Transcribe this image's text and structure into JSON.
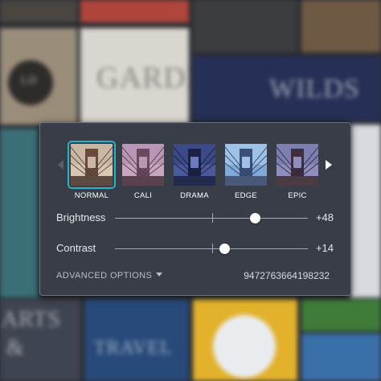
{
  "background_tiles": {
    "top_left": "LD",
    "garden": "GARDEN",
    "wild": "WILDS",
    "arts": "ARTS",
    "arts_amp": "&",
    "travel": "TRAVEL"
  },
  "filter_panel": {
    "prev_icon": "chevron-left-icon",
    "next_icon": "chevron-right-icon",
    "selected_filter": "NORMAL",
    "filters": [
      {
        "label": "NORMAL"
      },
      {
        "label": "CALI"
      },
      {
        "label": "DRAMA"
      },
      {
        "label": "EDGE"
      },
      {
        "label": "EPIC"
      }
    ],
    "brightness": {
      "label": "Brightness",
      "value": "+48"
    },
    "contrast": {
      "label": "Contrast",
      "value": "+14"
    },
    "advanced_label": "ADVANCED OPTIONS",
    "code": "9472763664198232"
  },
  "colors": {
    "accent": "#25b3c6",
    "panel_bg": "#3a3e48"
  }
}
